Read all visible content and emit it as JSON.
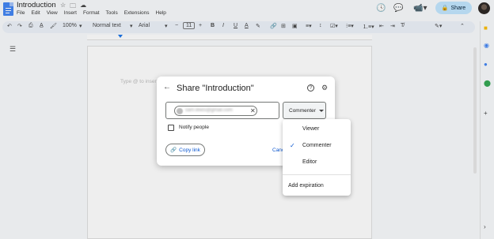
{
  "document": {
    "title": "Introduction",
    "placeholder": "Type @ to insert"
  },
  "menubar": [
    "File",
    "Edit",
    "View",
    "Insert",
    "Format",
    "Tools",
    "Extensions",
    "Help"
  ],
  "toolbar": {
    "zoom": "100%",
    "style": "Normal text",
    "font": "Arial",
    "font_size": "11"
  },
  "header": {
    "share_label": "Share"
  },
  "share_dialog": {
    "title": "Share \"Introduction\"",
    "help_glyph": "?",
    "role": "Commenter",
    "notify_label": "Notify people",
    "copy_link_label": "Copy link",
    "cancel_label": "Cancel",
    "chip_email": "sam.lewis@gmail.com"
  },
  "role_menu": {
    "items": [
      "Viewer",
      "Commenter",
      "Editor"
    ],
    "selected": "Commenter",
    "expiration_label": "Add expiration"
  },
  "colors": {
    "accent": "#0b57d0",
    "share_button": "#c2e7ff",
    "docs_blue": "#4285f4"
  }
}
